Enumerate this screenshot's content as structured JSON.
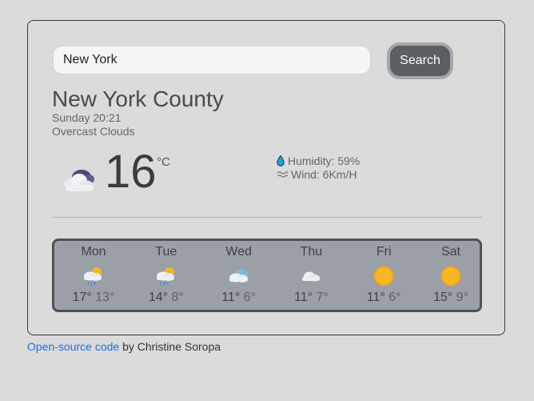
{
  "search": {
    "value": "New York",
    "button_label": "Search"
  },
  "current": {
    "city": "New York County",
    "datetime": "Sunday 20:21",
    "description": "Overcast Clouds",
    "temperature": "16",
    "unit": "°C",
    "humidity_label": "Humidity: 59%",
    "wind_label": "Wind: 6Km/H",
    "icon": "overcast-clouds-icon"
  },
  "forecast": [
    {
      "day": "Mon",
      "max": "17°",
      "min": "13°",
      "icon": "rain-sun-icon"
    },
    {
      "day": "Tue",
      "max": "14°",
      "min": "8°",
      "icon": "rain-sun-icon"
    },
    {
      "day": "Wed",
      "max": "11°",
      "min": "6°",
      "icon": "clouds-icon"
    },
    {
      "day": "Thu",
      "max": "11°",
      "min": "7°",
      "icon": "cloud-icon"
    },
    {
      "day": "Fri",
      "max": "11°",
      "min": "6°",
      "icon": "sun-icon"
    },
    {
      "day": "Sat",
      "max": "15°",
      "min": "9°",
      "icon": "sun-icon"
    }
  ],
  "footer": {
    "link_text": "Open-source code",
    "by_text": " by Christine Soropa"
  },
  "colors": {
    "background": "#dbdbdb",
    "button": "#5b5e63",
    "forecast_panel": "#9ba0a6",
    "link": "#1f6fe0"
  }
}
